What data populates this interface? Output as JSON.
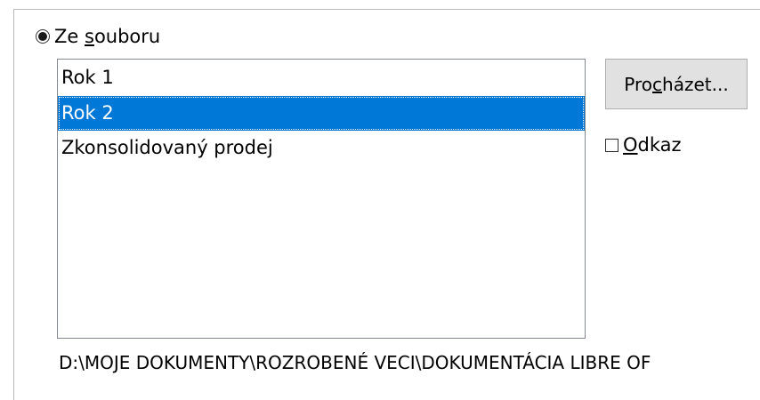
{
  "source_option": {
    "label_before": "Ze ",
    "label_accel": "s",
    "label_after": "ouboru",
    "selected": true
  },
  "sheet_list": {
    "items": [
      "Rok 1",
      "Rok 2",
      "Zkonsolidovaný prodej"
    ],
    "selected_index": 1
  },
  "browse_button": {
    "label_before": "Pro",
    "label_accel": "c",
    "label_after": "házet..."
  },
  "link_checkbox": {
    "label_accel": "O",
    "label_after": "dkaz",
    "checked": false
  },
  "file_path": "D:\\MOJE DOKUMENTY\\ROZROBENÉ VECI\\DOKUMENTÁCIA LIBRE OF",
  "colors": {
    "selection": "#0078d7",
    "button_face": "#e1e1e1"
  }
}
